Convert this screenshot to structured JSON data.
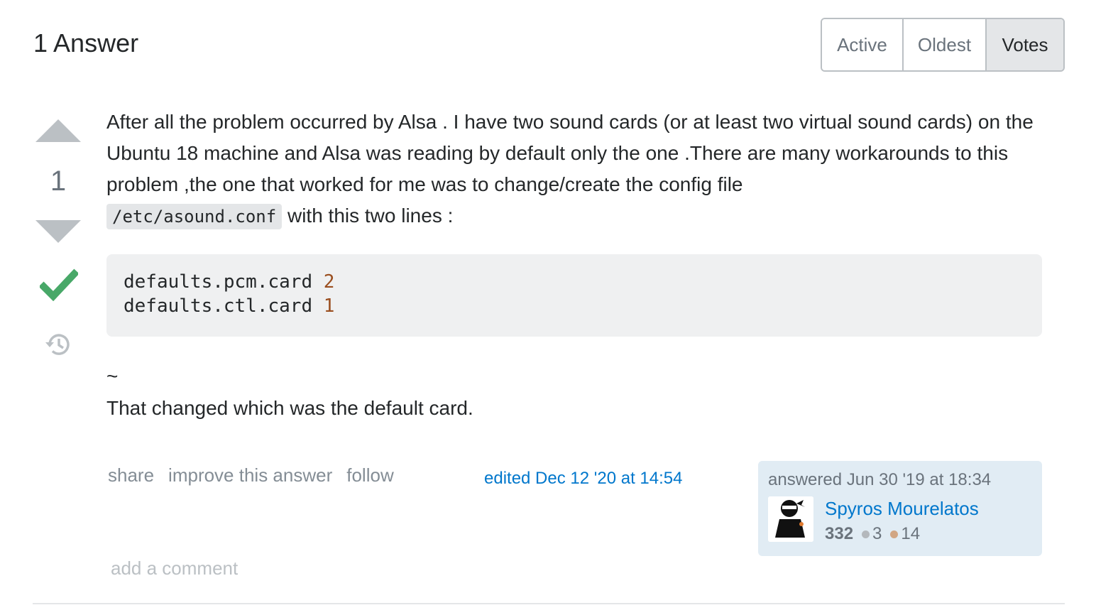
{
  "answers": {
    "header": "1 Answer"
  },
  "sort": {
    "active_label": "Active",
    "oldest_label": "Oldest",
    "votes_label": "Votes",
    "selected": "Votes"
  },
  "vote": {
    "count": "1",
    "accepted": true
  },
  "post": {
    "paragraph_part1": "After all the problem occurred by Alsa . I have two sound cards (or at least two virtual sound cards) on the Ubuntu 18 machine and Alsa was reading by default only the one .There are many workarounds to this problem ,the one that worked for me was to change/create the config file",
    "inline_code": "/etc/asound.conf",
    "paragraph_part2": " with this two lines :",
    "code_lines": [
      {
        "key": "defaults.pcm.card",
        "value": "2"
      },
      {
        "key": "defaults.ctl.card",
        "value": "1"
      }
    ],
    "tilde": "~",
    "closing": "That changed which was the default card."
  },
  "menu": {
    "share": "share",
    "improve": "improve this answer",
    "follow": "follow"
  },
  "edit": {
    "label": "edited Dec 12 '20 at 14:54"
  },
  "user": {
    "answered": "answered Jun 30 '19 at 18:34",
    "name": "Spyros Mourelatos",
    "reputation": "332",
    "silver_badges": "3",
    "bronze_badges": "14",
    "avatar_icon": "ninja-laptop-avatar"
  },
  "comment": {
    "add_label": "add a comment"
  },
  "colors": {
    "accent": "#0077cc",
    "accepted": "#48a868",
    "card_bg": "#e1ecf4",
    "code_bg": "#eff0f1",
    "number": "#9a4e1f"
  }
}
